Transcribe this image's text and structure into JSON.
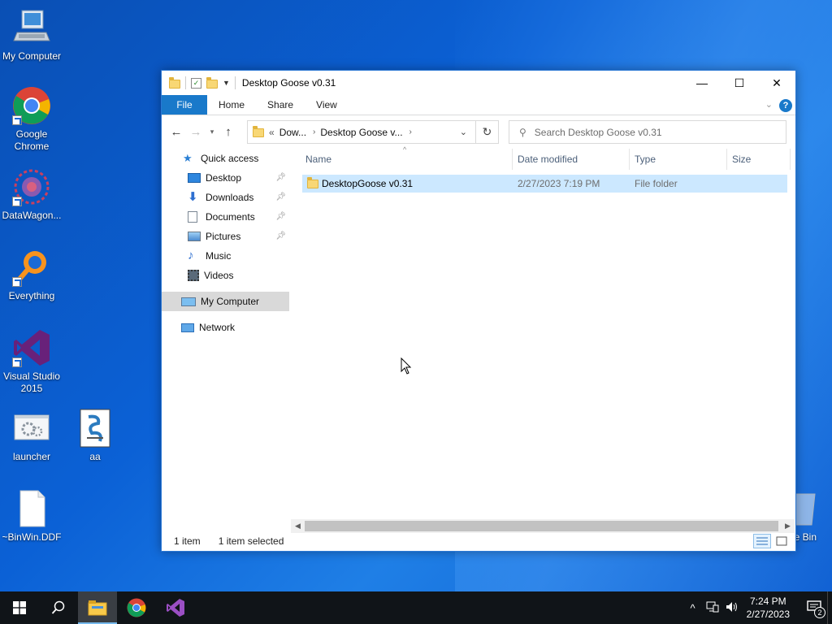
{
  "desktop": {
    "icons": [
      {
        "label": "My Computer",
        "icon": "computer-icon"
      },
      {
        "label": "Google\nChrome",
        "icon": "chrome-icon"
      },
      {
        "label": "DataWagon...",
        "icon": "datawagon-icon"
      },
      {
        "label": "Everything",
        "icon": "everything-search-icon"
      },
      {
        "label": "Visual Studio\n2015",
        "icon": "visual-studio-icon"
      },
      {
        "label": "launcher",
        "icon": "launcher-icon"
      },
      {
        "label": "aa",
        "icon": "script-file-icon"
      },
      {
        "label": "~BinWin.DDF",
        "icon": "blank-file-icon"
      },
      {
        "label": "e Bin",
        "icon": "recycle-bin-icon"
      }
    ]
  },
  "window": {
    "title": "Desktop Goose v0.31",
    "controls": {
      "minimize": "—",
      "maximize": "☐",
      "close": "✕"
    },
    "ribbon": {
      "tabs": [
        "File",
        "Home",
        "Share",
        "View"
      ],
      "help": "?"
    },
    "address": {
      "overflow": "«",
      "segments": [
        "Dow...",
        "Desktop Goose v..."
      ],
      "separator": "›",
      "refresh": "↻"
    },
    "search": {
      "placeholder": "Search Desktop Goose v0.31"
    },
    "nav_pane": {
      "quick_access": "Quick access",
      "pinned": [
        {
          "label": "Desktop",
          "pinned": true
        },
        {
          "label": "Downloads",
          "pinned": true
        },
        {
          "label": "Documents",
          "pinned": true
        },
        {
          "label": "Pictures",
          "pinned": true
        },
        {
          "label": "Music",
          "pinned": false
        },
        {
          "label": "Videos",
          "pinned": false
        }
      ],
      "my_computer": "My Computer",
      "network": "Network"
    },
    "columns": {
      "name": "Name",
      "date_modified": "Date modified",
      "type": "Type",
      "size": "Size"
    },
    "files": [
      {
        "name": "DesktopGoose v0.31",
        "date_modified": "2/27/2023 7:19 PM",
        "type": "File folder",
        "size": "",
        "selected": true
      }
    ],
    "status": {
      "count": "1 item",
      "selection": "1 item selected"
    }
  },
  "taskbar": {
    "apps": [
      "start-icon",
      "search-icon",
      "file-explorer-icon",
      "chrome-icon",
      "visual-studio-icon"
    ],
    "clock": {
      "time": "7:24 PM",
      "date": "2/27/2023"
    },
    "notifications_count": "2",
    "tray_chevron": "^"
  },
  "colors": {
    "accent": "#1979ca",
    "selection": "#cce8ff",
    "taskbar": "#101418"
  }
}
